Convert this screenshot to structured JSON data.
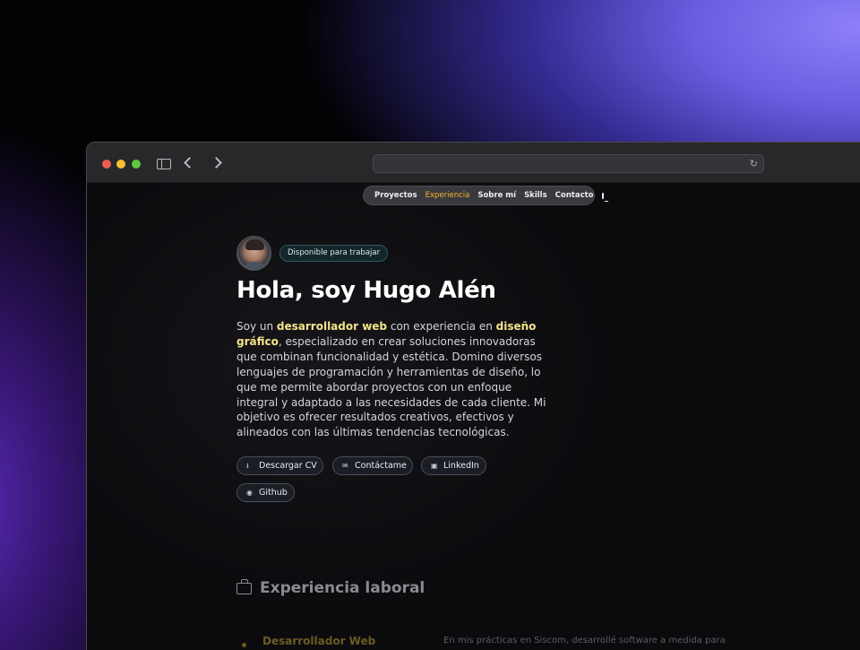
{
  "nav": {
    "items": [
      {
        "label": "Proyectos",
        "active": false
      },
      {
        "label": "Experiencia",
        "active": true
      },
      {
        "label": "Sobre mí",
        "active": false
      },
      {
        "label": "Skills",
        "active": false
      },
      {
        "label": "Contacto",
        "active": false
      }
    ],
    "theme_icon": "monitor-icon"
  },
  "hero": {
    "badge": "Disponible para trabajar",
    "title": "Hola, soy Hugo Alén",
    "bio": {
      "p1": "Soy un ",
      "h1": "desarrollador web",
      "p2": " con experiencia en ",
      "h2": "diseño gráfico",
      "p3": ", especializado en crear soluciones innovadoras que combinan funcionalidad y estética. Domino diversos lenguajes de programación y herramientas de diseño, lo que me permite abordar proyectos con un enfoque integral y adaptado a las necesidades de cada cliente. Mi objetivo es ofrecer resultados creativos, efectivos y alineados con las últimas tendencias tecnológicas."
    },
    "buttons": {
      "cv": "Descargar CV",
      "contact": "Contáctame",
      "linkedin": "LinkedIn",
      "github": "Github"
    }
  },
  "experience": {
    "title": "Experiencia laboral",
    "first_job_title": "Desarrollador Web",
    "first_job_desc": "En mis prácticas en Siscom, desarrollé software a medida para"
  },
  "colors": {
    "accent_nav": "#f2b527",
    "highlight": "#f5e38a"
  }
}
